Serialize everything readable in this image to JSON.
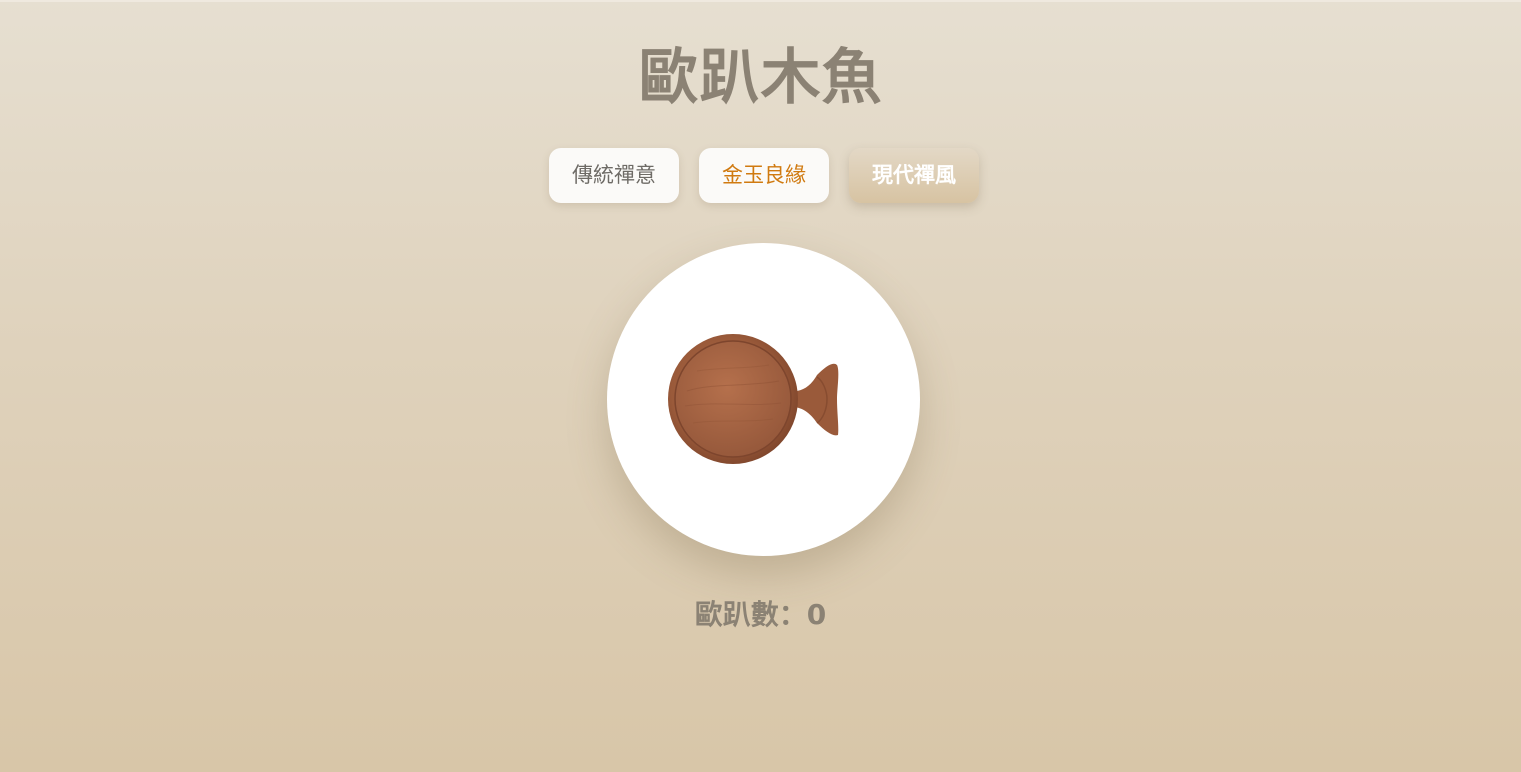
{
  "app": {
    "title": "歐趴木魚"
  },
  "themes": [
    {
      "label": "傳統禪意",
      "text_color": "#6e6b66",
      "selected": false
    },
    {
      "label": "金玉良緣",
      "text_color": "#d07a10",
      "selected": false
    },
    {
      "label": "現代禪風",
      "text_color": "#ffffff",
      "selected": true
    }
  ],
  "fish": {
    "icon": "wooden-fish-icon",
    "wood_color": "#9a5a3a"
  },
  "counter": {
    "label": "歐趴數：",
    "value": "0"
  }
}
